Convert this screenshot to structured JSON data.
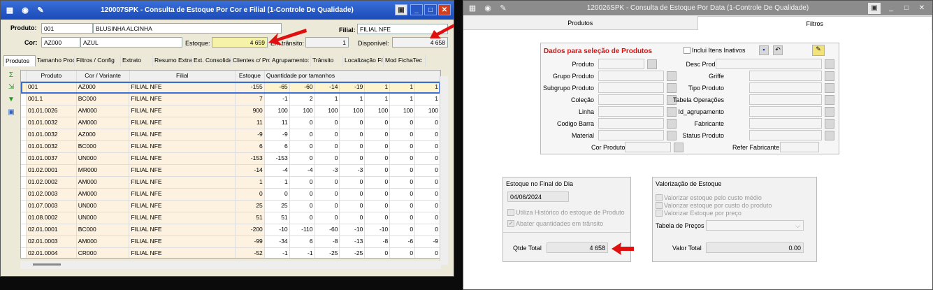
{
  "win1": {
    "title": "120007SPK - Consulta de Estoque Por Cor e Filial (1-Controle De Qualidade)",
    "produto_label": "Produto:",
    "produto_code": "001",
    "produto_desc": "BLUSINHA ALCINHA",
    "filial_label": "Filial:",
    "filial_value": "FILIAL NFE",
    "cor_label": "Cor:",
    "cor_code": "AZ000",
    "cor_desc": "AZUL",
    "estoque_label": "Estoque:",
    "estoque_value": "4 659",
    "transito_label": "Em trânsito:",
    "transito_value": "1",
    "disponivel_label": "Disponível:",
    "disponivel_value": "4 658",
    "tabs": [
      "Produtos",
      "Tamanho Proc",
      "Filtros / Config",
      "Extrato",
      "Resumo Extra",
      "Ext. Consolida",
      "Clientes c/ Pro",
      "Agrupamento:",
      "Trânsito",
      "Localização Fí:",
      "Mod FichaTec"
    ],
    "columns": [
      "Produto",
      "Cor / Variante",
      "Filial",
      "Estoque",
      "Quantidade por tamanhos"
    ],
    "rows": [
      {
        "produto": "001",
        "cor": "AZ000",
        "filial": "FILIAL NFE",
        "estoque": "-155",
        "q": [
          "-65",
          "-60",
          "-14",
          "-19",
          "1",
          "1",
          "1"
        ]
      },
      {
        "produto": "001.1",
        "cor": "BC000",
        "filial": "FILIAL NFE",
        "estoque": "7",
        "q": [
          "-1",
          "2",
          "1",
          "1",
          "1",
          "1",
          "1"
        ]
      },
      {
        "produto": "01.01.0026",
        "cor": "AM000",
        "filial": "FILIAL NFE",
        "estoque": "900",
        "q": [
          "100",
          "100",
          "100",
          "100",
          "100",
          "100",
          "100"
        ]
      },
      {
        "produto": "01.01.0032",
        "cor": "AM000",
        "filial": "FILIAL NFE",
        "estoque": "11",
        "q": [
          "11",
          "0",
          "0",
          "0",
          "0",
          "0",
          "0"
        ]
      },
      {
        "produto": "01.01.0032",
        "cor": "AZ000",
        "filial": "FILIAL NFE",
        "estoque": "-9",
        "q": [
          "-9",
          "0",
          "0",
          "0",
          "0",
          "0",
          "0"
        ]
      },
      {
        "produto": "01.01.0032",
        "cor": "BC000",
        "filial": "FILIAL NFE",
        "estoque": "6",
        "q": [
          "6",
          "0",
          "0",
          "0",
          "0",
          "0",
          "0"
        ]
      },
      {
        "produto": "01.01.0037",
        "cor": "UN000",
        "filial": "FILIAL NFE",
        "estoque": "-153",
        "q": [
          "-153",
          "0",
          "0",
          "0",
          "0",
          "0",
          "0"
        ]
      },
      {
        "produto": "01.02.0001",
        "cor": "MR000",
        "filial": "FILIAL NFE",
        "estoque": "-14",
        "q": [
          "-4",
          "-4",
          "-3",
          "-3",
          "0",
          "0",
          "0"
        ]
      },
      {
        "produto": "01.02.0002",
        "cor": "AM000",
        "filial": "FILIAL NFE",
        "estoque": "1",
        "q": [
          "1",
          "0",
          "0",
          "0",
          "0",
          "0",
          "0"
        ]
      },
      {
        "produto": "01.02.0003",
        "cor": "AM000",
        "filial": "FILIAL NFE",
        "estoque": "0",
        "q": [
          "0",
          "0",
          "0",
          "0",
          "0",
          "0",
          "0"
        ]
      },
      {
        "produto": "01.07.0003",
        "cor": "UN000",
        "filial": "FILIAL NFE",
        "estoque": "25",
        "q": [
          "25",
          "0",
          "0",
          "0",
          "0",
          "0",
          "0"
        ]
      },
      {
        "produto": "01.08.0002",
        "cor": "UN000",
        "filial": "FILIAL NFE",
        "estoque": "51",
        "q": [
          "51",
          "0",
          "0",
          "0",
          "0",
          "0",
          "0"
        ]
      },
      {
        "produto": "02.01.0001",
        "cor": "BC000",
        "filial": "FILIAL NFE",
        "estoque": "-200",
        "q": [
          "-10",
          "-110",
          "-60",
          "-10",
          "-10",
          "0",
          "0"
        ]
      },
      {
        "produto": "02.01.0003",
        "cor": "AM000",
        "filial": "FILIAL NFE",
        "estoque": "-99",
        "q": [
          "-34",
          "6",
          "-8",
          "-13",
          "-8",
          "-6",
          "-9"
        ]
      },
      {
        "produto": "02.01.0004",
        "cor": "CR000",
        "filial": "FILIAL NFE",
        "estoque": "-52",
        "q": [
          "-1",
          "-1",
          "-25",
          "-25",
          "0",
          "0",
          "0"
        ]
      }
    ]
  },
  "win2": {
    "title": "120026SPK - Consulta de Estoque Por Data (1-Controle De Qualidade)",
    "tabs": [
      "Produtos",
      "Filtros"
    ],
    "section_title": "Dados para seleção de Produtos",
    "incluir_inativos": "Inclui Itens Inativos",
    "left_fields": [
      "Produto",
      "Grupo Produto",
      "Subgrupo Produto",
      "Coleção",
      "Linha",
      "Codigo Barra",
      "Material"
    ],
    "cor_produto": "Cor Produto",
    "right_fields": [
      "Desc Produto",
      "Griffe",
      "Tipo Produto",
      "Tabela Operações",
      "Id_agrupamento",
      "Fabricante",
      "Status Produto"
    ],
    "ref_fabricante": "Refer Fabricante",
    "estoque_final_title": "Estoque no Final do Dia",
    "data": "04/06/2024",
    "utiliza_hist": "Utiliza Histórico do estoque de Produto",
    "abater": "Abater quantidades em trânsito",
    "qtde_label": "Qtde Total",
    "qtde_value": "4 658",
    "valorizacao_title": "Valorização de Estoque",
    "val_opts": [
      "Valorizar estoque pelo custo médio",
      "Valorizar estoque por custo do produto",
      "Valorizar Estoque por preço"
    ],
    "tabela_precos": "Tabela de Preços",
    "valor_total_label": "Valor Total",
    "valor_total": "0.00"
  },
  "colors": {
    "accent": "#e01010",
    "title_blue": "#2a5fd0",
    "selection": "#3a6fd8"
  }
}
